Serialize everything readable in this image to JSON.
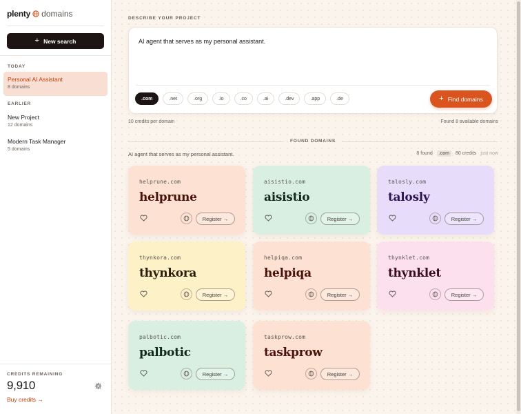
{
  "app": {
    "brand_name": "plenty",
    "brand_suffix": "domains"
  },
  "sidebar": {
    "new_search_label": "New search",
    "today_label": "TODAY",
    "earlier_label": "EARLIER",
    "projects": [
      {
        "name": "Personal AI Assistant",
        "count": "8 domains",
        "active": true
      },
      {
        "name": "New Project",
        "count": "12 domains",
        "active": false
      },
      {
        "name": "Modern Task Manager",
        "count": "5 domains",
        "active": false
      }
    ],
    "credits_label": "CREDITS REMAINING",
    "credits_value": "9,910",
    "buy_credits_label": "Buy credits →"
  },
  "search": {
    "section_label": "DESCRIBE YOUR PROJECT",
    "prompt": "AI agent that serves as my personal assistant.",
    "tlds": [
      ".com",
      ".net",
      ".org",
      ".io",
      ".co",
      ".ai",
      ".dev",
      ".app",
      ".de"
    ],
    "selected_tld": ".com",
    "find_button_label": "Find domains",
    "cost_note": "10 credits per domain",
    "found_note": "Found 8 available domains"
  },
  "results": {
    "section_label": "FOUND DOMAINS",
    "query": "AI agent that serves as my personal assistant.",
    "found_count": "8 found",
    "tld_badge": ".com",
    "credits_used": "80 credits",
    "time": "just now",
    "register_label": "Register →",
    "cards": [
      {
        "domain": "helprune.com",
        "name": "helprune",
        "bg": "#fde1d2",
        "fg": "#4a1208"
      },
      {
        "domain": "aisistio.com",
        "name": "aisistio",
        "bg": "#d8efe2",
        "fg": "#0f2a1c"
      },
      {
        "domain": "talosly.com",
        "name": "talosly",
        "bg": "#e7ddfb",
        "fg": "#2a1456"
      },
      {
        "domain": "thynkora.com",
        "name": "thynkora",
        "bg": "#fdf1c7",
        "fg": "#2a1e0a"
      },
      {
        "domain": "helpiqa.com",
        "name": "helpiqa",
        "bg": "#fde1d2",
        "fg": "#4a1208"
      },
      {
        "domain": "thynklet.com",
        "name": "thynklet",
        "bg": "#fde0ee",
        "fg": "#3a0c1c"
      },
      {
        "domain": "palbotic.com",
        "name": "palbotic",
        "bg": "#d8efe2",
        "fg": "#0f2a1c"
      },
      {
        "domain": "taskprow.com",
        "name": "taskprow",
        "bg": "#fde1d2",
        "fg": "#4a1208"
      }
    ]
  },
  "colors": {
    "accent": "#d9541e",
    "sidebar_active_bg": "#f9ded3",
    "dark_button": "#1c1513"
  }
}
